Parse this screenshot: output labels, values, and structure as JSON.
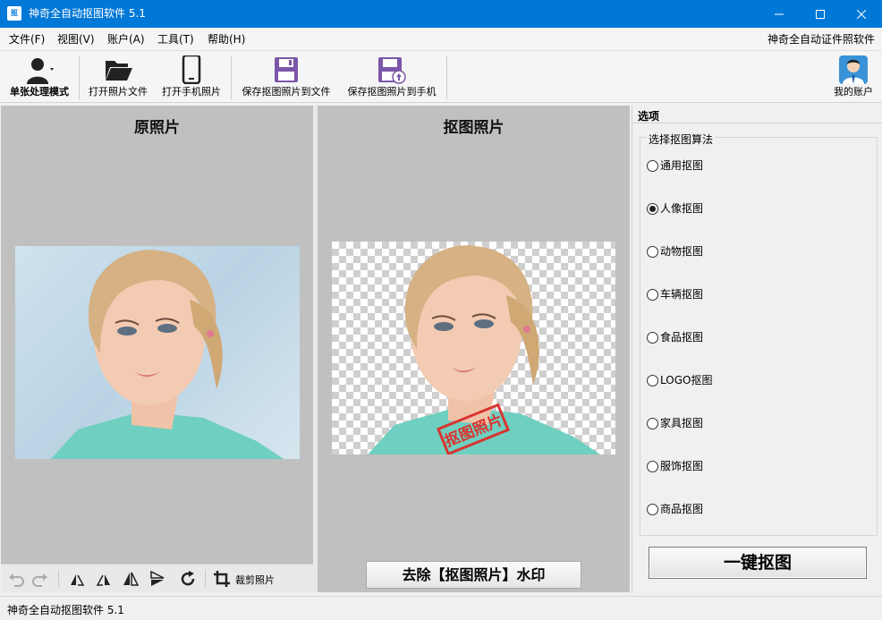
{
  "window": {
    "title": "神奇全自动抠图软件 5.1",
    "icon_glyph": "抠"
  },
  "menu": {
    "items": [
      "文件(F)",
      "视图(V)",
      "账户(A)",
      "工具(T)",
      "帮助(H)"
    ],
    "right_link": "神奇全自动证件照软件"
  },
  "toolbar": {
    "single_mode": "单张处理模式",
    "open_file": "打开照片文件",
    "open_phone": "打开手机照片",
    "save_file": "保存抠图照片到文件",
    "save_phone": "保存抠图照片到手机",
    "account": "我的账户"
  },
  "panels": {
    "original_title": "原照片",
    "cutout_title": "抠图照片",
    "stamp_text": "抠图照片"
  },
  "image_tools": {
    "crop_label": "裁剪照片"
  },
  "watermark_button": "去除【抠图照片】水印",
  "options": {
    "header": "选项",
    "group_title": "选择抠图算法",
    "algorithms": [
      "通用抠图",
      "人像抠图",
      "动物抠图",
      "车辆抠图",
      "食品抠图",
      "LOGO抠图",
      "家具抠图",
      "服饰抠图",
      "商品抠图"
    ],
    "selected": "人像抠图",
    "run_button": "一键抠图"
  },
  "status": {
    "text": "神奇全自动抠图软件 5.1"
  },
  "colors": {
    "titlebar": "#0078d7",
    "save_icon": "#7c56a8",
    "panel_bg": "#c0c0c0"
  }
}
